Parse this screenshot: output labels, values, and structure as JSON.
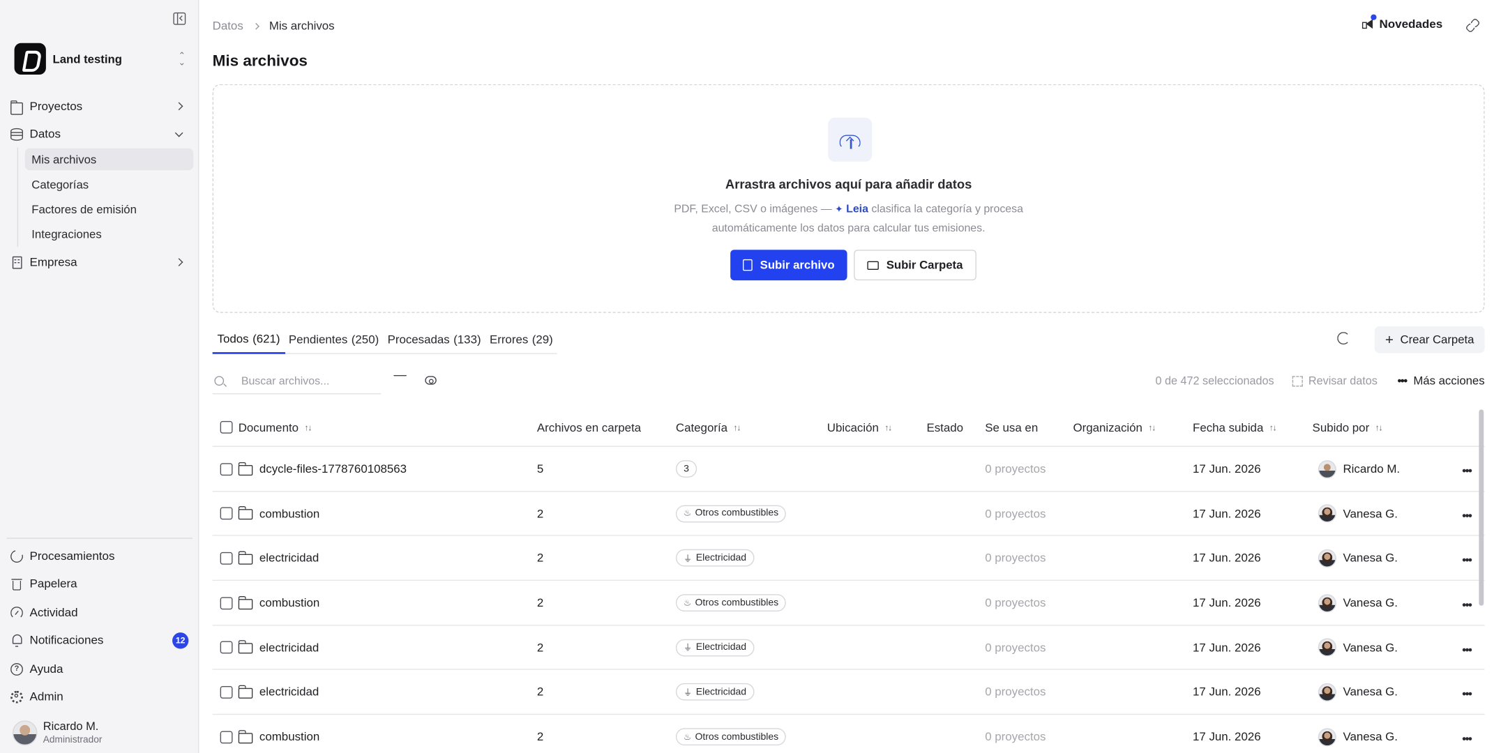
{
  "sidebar": {
    "workspace": "Land testing",
    "nav": [
      {
        "label": "Proyectos"
      },
      {
        "label": "Datos"
      },
      {
        "label": "Empresa"
      }
    ],
    "datos_sub": [
      "Mis archivos",
      "Categorías",
      "Factores de emisión",
      "Integraciones"
    ],
    "bottom": [
      {
        "label": "Procesamientos"
      },
      {
        "label": "Papelera"
      },
      {
        "label": "Actividad"
      },
      {
        "label": "Notificaciones",
        "badge": "12"
      },
      {
        "label": "Ayuda"
      },
      {
        "label": "Admin"
      }
    ],
    "user": {
      "name": "Ricardo M.",
      "role": "Administrador"
    }
  },
  "header": {
    "breadcrumb_root": "Datos",
    "breadcrumb_current": "Mis archivos",
    "novedades": "Novedades",
    "title": "Mis archivos"
  },
  "dropzone": {
    "title": "Arrastra archivos aquí para añadir datos",
    "desc_before": "PDF, Excel, CSV o imágenes —",
    "leia": "Leia",
    "desc_after": "clasifica la categoría y procesa",
    "desc_line2": "automáticamente los datos para calcular tus emisiones.",
    "upload_file": "Subir archivo",
    "upload_folder": "Subir Carpeta"
  },
  "tabs": [
    {
      "label": "Todos",
      "count": "(621)"
    },
    {
      "label": "Pendientes",
      "count": "(250)"
    },
    {
      "label": "Procesadas",
      "count": "(133)"
    },
    {
      "label": "Errores",
      "count": "(29)"
    }
  ],
  "actions": {
    "crear_carpeta": "Crear Carpeta",
    "search_placeholder": "Buscar archivos...",
    "selected": "0 de 472 seleccionados",
    "revisar": "Revisar datos",
    "mas_acciones": "Más acciones"
  },
  "table": {
    "columns": [
      "Documento",
      "Archivos en carpeta",
      "Categoría",
      "Ubicación",
      "Estado",
      "Se usa en",
      "Organización",
      "Fecha subida",
      "Subido por"
    ],
    "rows": [
      {
        "doc": "dcycle-files-1778760108563",
        "files": "5",
        "category": "3",
        "cat_type": "num",
        "used": "0 proyectos",
        "date": "17 Jun. 2026",
        "by": "Ricardo M."
      },
      {
        "doc": "combustion",
        "files": "2",
        "category": "Otros combustibles",
        "cat_type": "flame",
        "used": "0 proyectos",
        "date": "17 Jun. 2026",
        "by": "Vanesa G."
      },
      {
        "doc": "electricidad",
        "files": "2",
        "category": "Electricidad",
        "cat_type": "plug",
        "used": "0 proyectos",
        "date": "17 Jun. 2026",
        "by": "Vanesa G."
      },
      {
        "doc": "combustion",
        "files": "2",
        "category": "Otros combustibles",
        "cat_type": "flame",
        "used": "0 proyectos",
        "date": "17 Jun. 2026",
        "by": "Vanesa G."
      },
      {
        "doc": "electricidad",
        "files": "2",
        "category": "Electricidad",
        "cat_type": "plug",
        "used": "0 proyectos",
        "date": "17 Jun. 2026",
        "by": "Vanesa G."
      },
      {
        "doc": "electricidad",
        "files": "2",
        "category": "Electricidad",
        "cat_type": "plug",
        "used": "0 proyectos",
        "date": "17 Jun. 2026",
        "by": "Vanesa G."
      },
      {
        "doc": "combustion",
        "files": "2",
        "category": "Otros combustibles",
        "cat_type": "flame",
        "used": "0 proyectos",
        "date": "17 Jun. 2026",
        "by": "Vanesa G."
      }
    ]
  }
}
